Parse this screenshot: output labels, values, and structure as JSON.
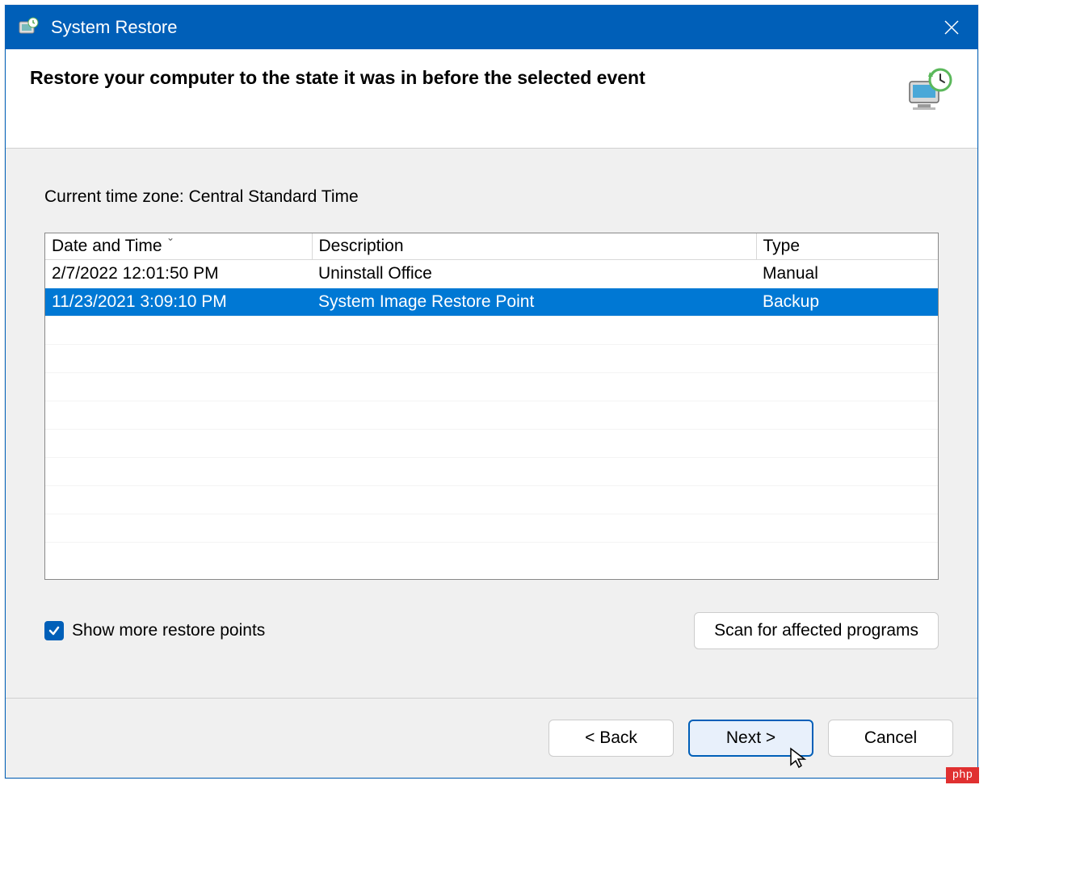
{
  "titlebar": {
    "title": "System Restore"
  },
  "header": {
    "title": "Restore your computer to the state it was in before the selected event"
  },
  "timezone_label": "Current time zone: Central Standard Time",
  "columns": {
    "date": "Date and Time",
    "description": "Description",
    "type": "Type"
  },
  "rows": [
    {
      "date": "2/7/2022 12:01:50 PM",
      "description": "Uninstall Office",
      "type": "Manual",
      "selected": false
    },
    {
      "date": "11/23/2021 3:09:10 PM",
      "description": "System Image Restore Point",
      "type": "Backup",
      "selected": true
    }
  ],
  "checkbox": {
    "label": "Show more restore points",
    "checked": true
  },
  "scan_button": "Scan for affected programs",
  "footer": {
    "back": "< Back",
    "next": "Next >",
    "cancel": "Cancel"
  },
  "watermark": "php"
}
